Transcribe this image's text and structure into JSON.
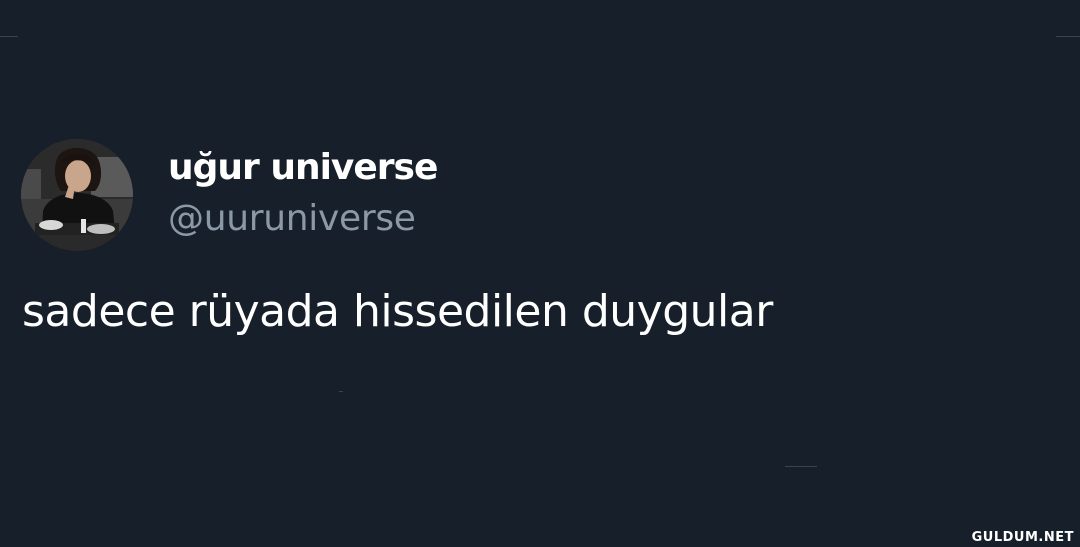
{
  "tweet": {
    "display_name": "uğur universe",
    "handle": "@uuruniverse",
    "text": "sadece rüyada hissedilen duygular"
  },
  "watermark": {
    "text": "GULDUM.NET"
  },
  "colors": {
    "background": "#17202a",
    "primary_text": "#ffffff",
    "secondary_text": "#8b98a5"
  }
}
